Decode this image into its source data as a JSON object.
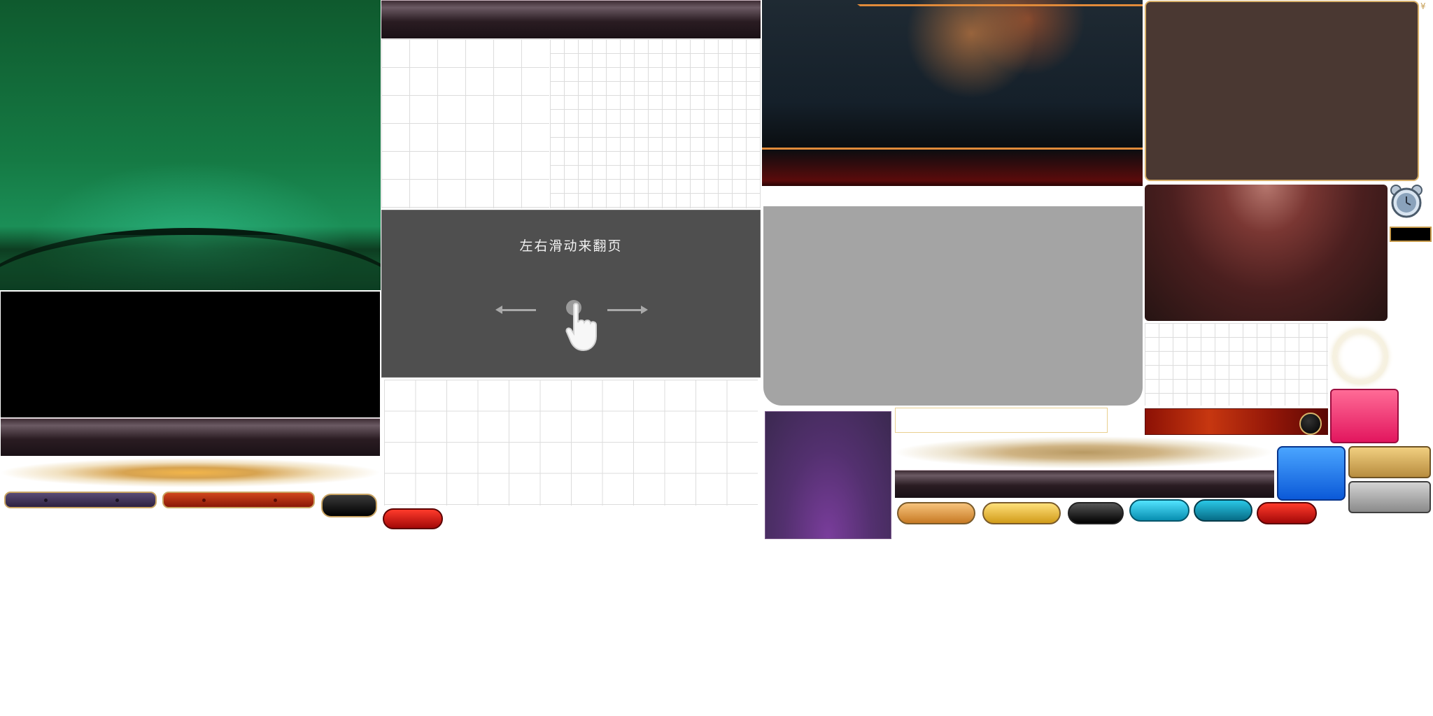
{
  "tutorial": {
    "hint_text": "左右滑动来翻页"
  },
  "corner": {
    "mark": "¥"
  },
  "icons": {
    "hand": "hand-swipe-icon",
    "arrow_left": "arrow-left-icon",
    "arrow_right": "arrow-right-icon",
    "alarm": "alarm-clock-icon"
  },
  "colors": {
    "felt_green": "#157a44",
    "tutorial_bg": "#4f4f4f",
    "gray_panel": "#a4a4a4",
    "brown_panel": "#4a3832",
    "gold_border": "#d7b06a",
    "purple_panel": "#53306f",
    "red_bar": "#c73710",
    "pink_button": "#e2165e",
    "blue_button": "#0b59d8"
  }
}
